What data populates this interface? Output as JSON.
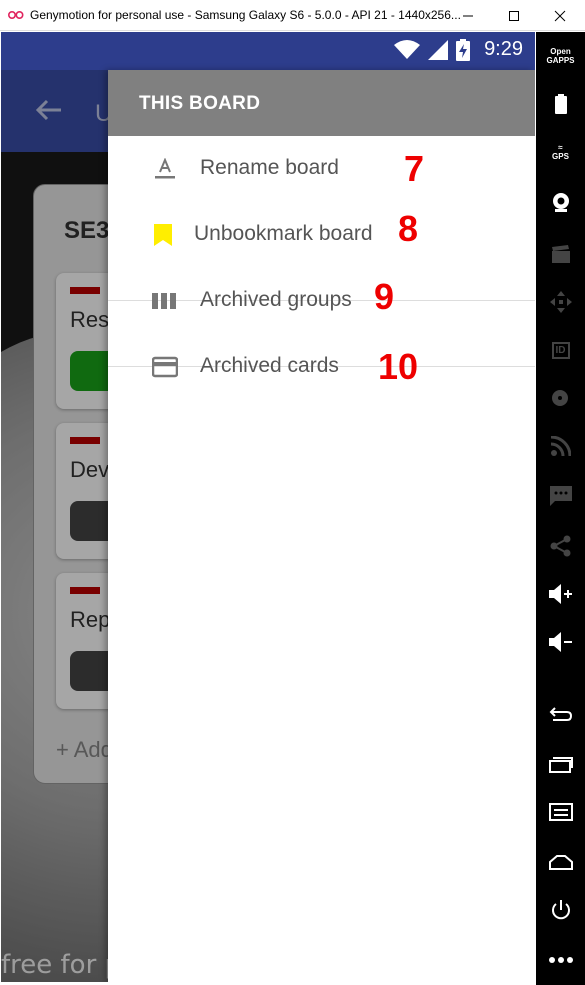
{
  "window": {
    "title": "Genymotion for personal use - Samsung Galaxy S6 - 5.0.0 - API 21 - 1440x256..."
  },
  "statusbar": {
    "time": "9:29"
  },
  "background_app": {
    "title_partial": "U",
    "board_name_partial": "SE3",
    "cards": [
      {
        "title_partial": "Res",
        "badge_color": "#1aa31a"
      },
      {
        "title_partial": "Dev",
        "badge_color": "#444444"
      },
      {
        "title_partial": "Rep",
        "badge_color": "#444444"
      }
    ],
    "add_label_partial": "+ Add"
  },
  "drawer": {
    "header": "THIS BOARD",
    "items": [
      {
        "label": "Rename board",
        "icon": "text-format-icon",
        "annotation": "7"
      },
      {
        "label": "Unbookmark board",
        "icon": "bookmark-icon",
        "annotation": "8"
      },
      {
        "label": "Archived groups",
        "icon": "columns-icon",
        "annotation": "9"
      },
      {
        "label": "Archived cards",
        "icon": "card-icon",
        "annotation": "10"
      }
    ]
  },
  "sidebar": {
    "opengapps": "Open\nGAPPS",
    "gps": "GPS",
    "id": "ID"
  },
  "watermark": "free for personal use",
  "colors": {
    "statusbar": "#2d3d8c",
    "appbar": "#3a4da8",
    "drawer_header": "#808080",
    "annotation": "#e00000",
    "bookmark": "#ffee00"
  }
}
